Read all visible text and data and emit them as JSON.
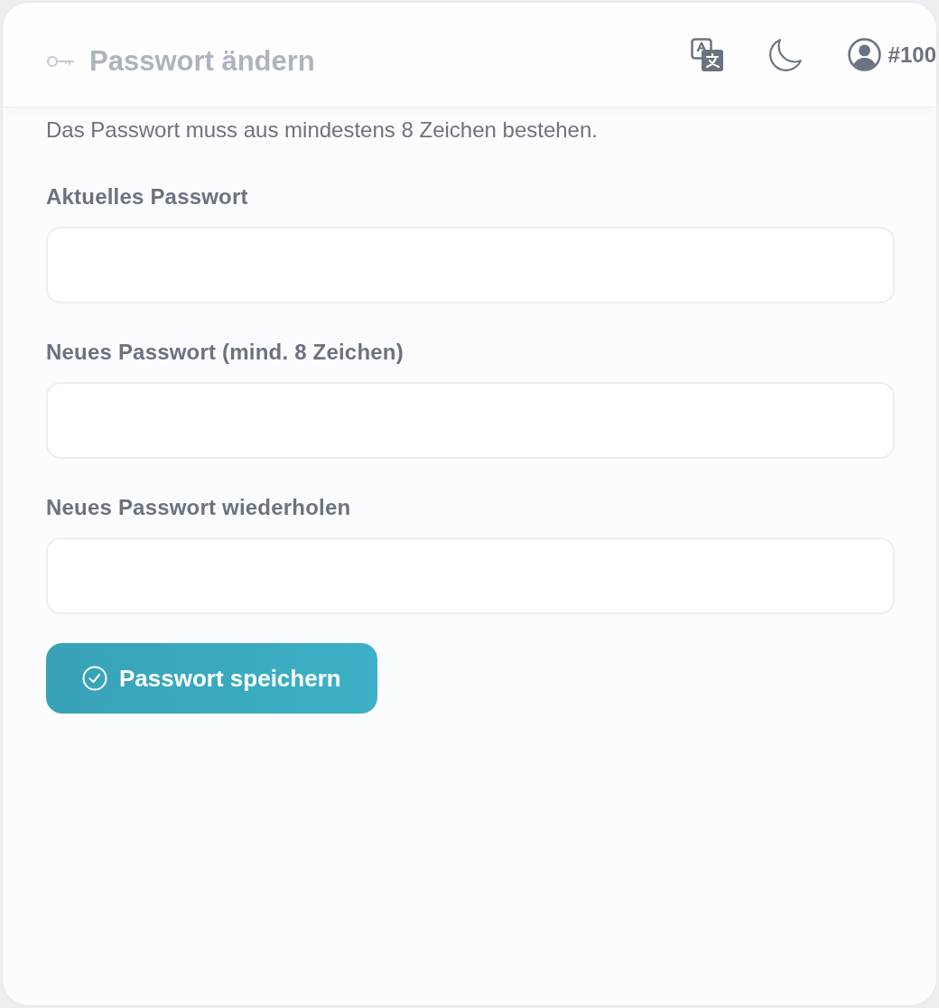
{
  "header": {
    "title": "Passwort ändern",
    "account": {
      "label": "#100"
    }
  },
  "description": "Das Passwort muss aus mindestens 8 Zeichen bestehen.",
  "fields": [
    {
      "label": "Aktuelles Passwort"
    },
    {
      "label": "Neues Passwort (mind. 8 Zeichen)"
    },
    {
      "label": "Neues Passwort wiederholen"
    }
  ],
  "submit_button": {
    "label": "Passwort speichern"
  }
}
